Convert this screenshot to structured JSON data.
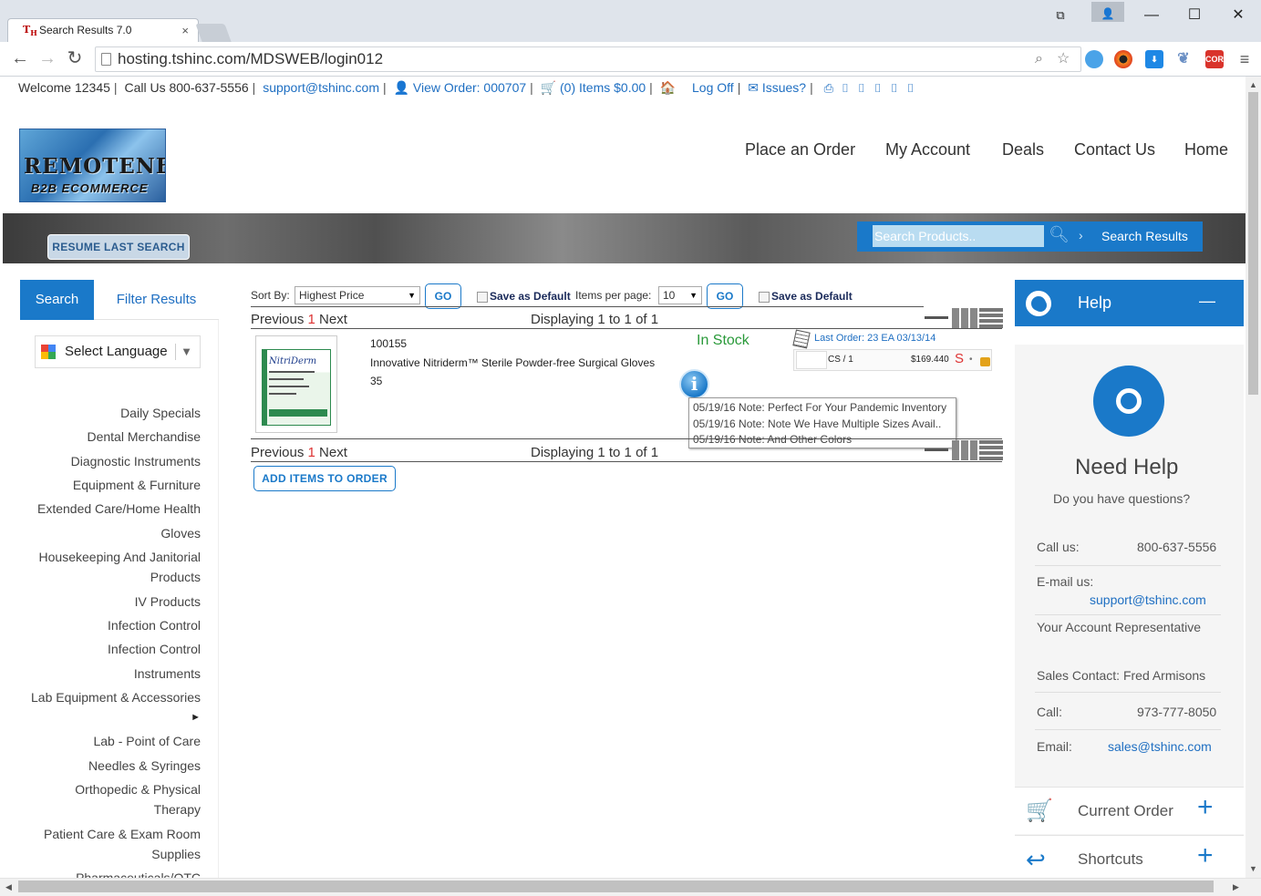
{
  "browser": {
    "tab_title": "Search Results 7.0",
    "tab_close": "×",
    "url": "hosting.tshinc.com/MDSWEB/login012",
    "ext_cors": "CORS"
  },
  "topbar": {
    "welcome": "Welcome 12345",
    "call": "Call Us 800-637-5556",
    "email": "support@tshinc.com",
    "view_order": "View Order: 000707",
    "items": "(0) Items $0.00",
    "logoff": "Log Off",
    "issues": "Issues?"
  },
  "logo": {
    "line1": "REMOTENE",
    "line2": "B2B ECOMMERCE"
  },
  "nav": [
    "Place an Order",
    "My Account",
    "Deals",
    "Contact Us",
    "Home"
  ],
  "banner": {
    "resume": "RESUME LAST SEARCH",
    "search_placeholder": "Search Products..",
    "breadcrumb": "Search Results"
  },
  "left": {
    "tab_search": "Search",
    "tab_filter": "Filter Results",
    "language": "Select Language",
    "categories": [
      "Daily Specials",
      "Dental Merchandise",
      "Diagnostic Instruments",
      "Equipment & Furniture",
      "Extended Care/Home Health",
      "Gloves",
      "Housekeeping And Janitorial",
      "Products",
      "IV Products",
      "Infection Control",
      "Infection Control",
      "Instruments",
      "Lab Equipment & Accessories",
      "►",
      "Lab - Point of Care",
      "Needles & Syringes",
      "Orthopedic & Physical",
      "Therapy",
      "Patient Care & Exam Room",
      "Supplies",
      "Pharmaceuticals/OTC"
    ]
  },
  "controls": {
    "sort_label": "Sort By:",
    "sort_value": "Highest Price",
    "go": "GO",
    "save_default": "Save as Default",
    "ipp_label": "Items per page:",
    "ipp_value": "10"
  },
  "pager": {
    "previous": "Previous",
    "page": "1",
    "next": "Next",
    "displaying": "Displaying 1 to 1 of 1"
  },
  "product": {
    "img_brand": "NitriDerm",
    "item_no": "100155",
    "name": "Innovative Nitriderm™ Sterile Powder-free Surgical Gloves",
    "qty": "35",
    "stock": "In Stock",
    "last_order": "Last Order: 23 EA 03/13/14",
    "uom": "CS / 1",
    "price": "$169.440",
    "price_flag": "S",
    "info": "i",
    "notes": [
      "05/19/16 Note: Perfect For Your Pandemic Inventory",
      "05/19/16 Note: Note We Have Multiple Sizes Avail..",
      "05/19/16 Note: And Other Colors"
    ]
  },
  "add_items": "ADD ITEMS TO ORDER",
  "help": {
    "title": "Help",
    "collapse": "—",
    "need_help": "Need Help",
    "question": "Do you have questions?",
    "call_label": "Call us:",
    "call_value": "800-637-5556",
    "email_label": "E-mail us:",
    "email_value": "support@tshinc.com",
    "rep": "Your Account Representative",
    "sales": "Sales Contact: Fred Armisons",
    "call2_label": "Call:",
    "call2_value": "973-777-8050",
    "email2_label": "Email:",
    "email2_value": "sales@tshinc.com",
    "current_order": "Current Order",
    "shortcuts": "Shortcuts",
    "plus": "+"
  }
}
